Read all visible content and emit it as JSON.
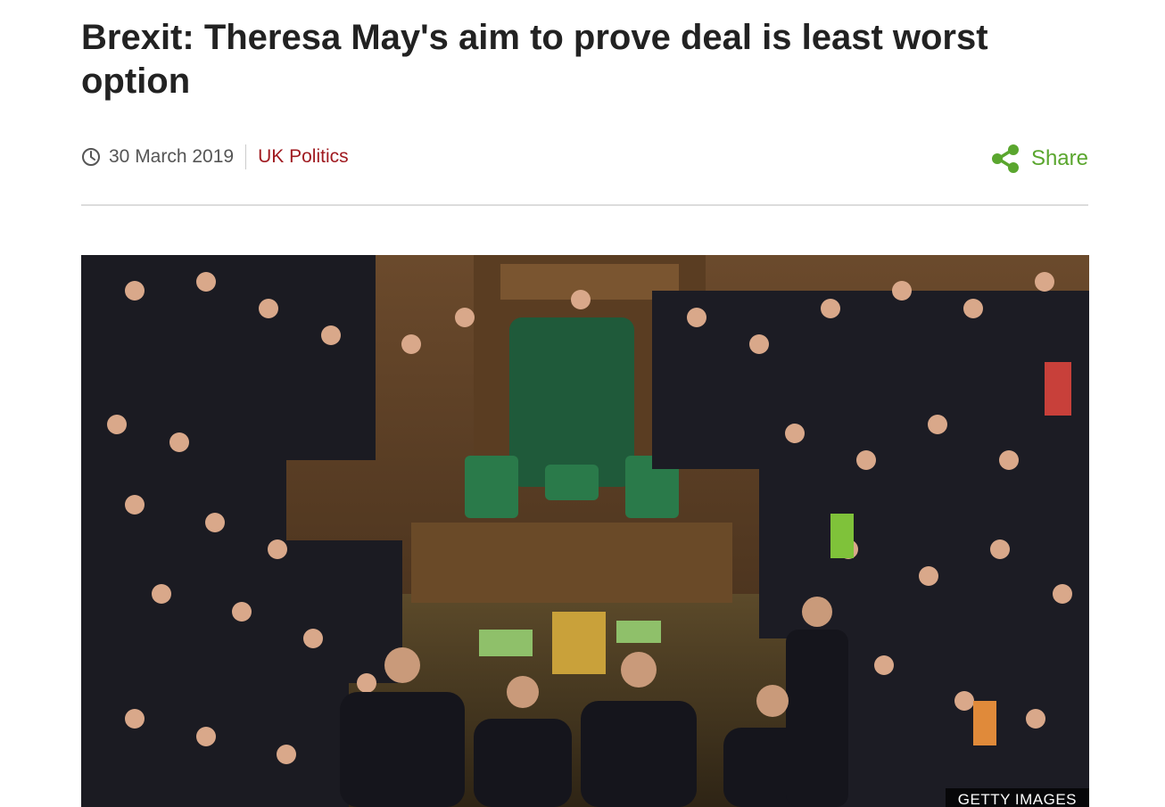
{
  "article": {
    "headline": "Brexit: Theresa May's aim to prove deal is least worst option",
    "date": "30 March 2019",
    "section": "UK Politics",
    "share_label": "Share"
  },
  "image": {
    "credit": "GETTY IMAGES"
  },
  "icons": {
    "clock": "clock-icon",
    "share": "share-icon"
  },
  "colors": {
    "headline": "#222222",
    "meta_text": "#555555",
    "section_link": "#a01b21",
    "share_accent": "#5aa62e",
    "rule": "#dcdcdc"
  }
}
